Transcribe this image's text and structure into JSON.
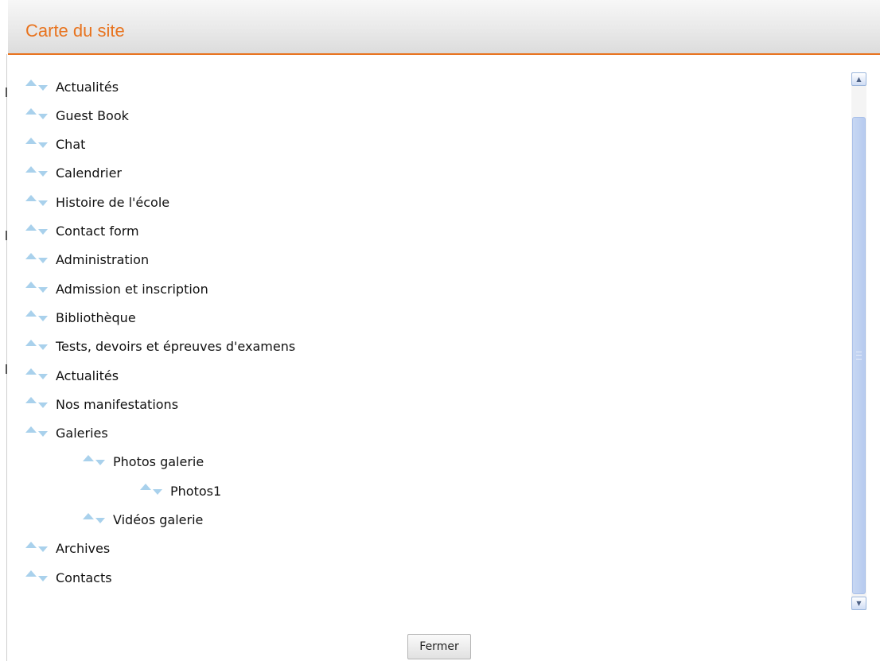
{
  "dialog": {
    "title": "Carte du site",
    "accent_color": "#e8731e",
    "arrow_color": "#a9d1ec",
    "icons": {
      "move_up": "arrow-up-icon",
      "move_down": "arrow-down-icon"
    }
  },
  "sitemap": {
    "items": [
      {
        "label": "Actualités",
        "level": 0
      },
      {
        "label": "Guest Book",
        "level": 0
      },
      {
        "label": "Chat",
        "level": 0
      },
      {
        "label": "Calendrier",
        "level": 0
      },
      {
        "label": "Histoire de l'école",
        "level": 0
      },
      {
        "label": "Contact form",
        "level": 0
      },
      {
        "label": "Administration",
        "level": 0
      },
      {
        "label": "Admission et inscription",
        "level": 0
      },
      {
        "label": "Bibliothèque",
        "level": 0
      },
      {
        "label": "Tests, devoirs et épreuves d'examens",
        "level": 0
      },
      {
        "label": "Actualités",
        "level": 0
      },
      {
        "label": "Nos manifestations",
        "level": 0
      },
      {
        "label": "Galeries",
        "level": 0
      },
      {
        "label": "Photos galerie",
        "level": 1
      },
      {
        "label": "Photos1",
        "level": 2
      },
      {
        "label": "Vidéos galerie",
        "level": 1
      },
      {
        "label": "Archives",
        "level": 0
      },
      {
        "label": "Contacts",
        "level": 0
      }
    ]
  },
  "footer": {
    "close_label": "Fermer"
  }
}
